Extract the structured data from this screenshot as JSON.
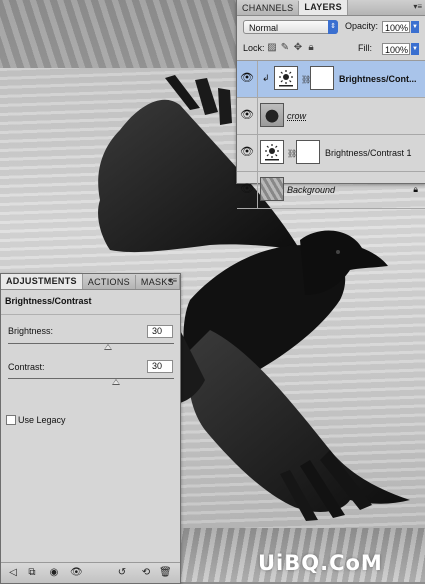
{
  "layers_panel": {
    "tabs": [
      "CHANNELS",
      "LAYERS"
    ],
    "active_tab": "LAYERS",
    "blend_mode": "Normal",
    "opacity_label": "Opacity:",
    "opacity_value": "100%",
    "lock_label": "Lock:",
    "fill_label": "Fill:",
    "fill_value": "100%",
    "layers": [
      {
        "name": "Brightness/Cont...",
        "type": "adjustment",
        "selected": true,
        "clipped": true
      },
      {
        "name": "crow",
        "type": "image",
        "selected": false
      },
      {
        "name": "Brightness/Contrast 1",
        "type": "adjustment",
        "selected": false
      },
      {
        "name": "Background",
        "type": "background",
        "selected": false,
        "locked": true
      }
    ]
  },
  "adjustments_panel": {
    "tabs": [
      "ADJUSTMENTS",
      "ACTIONS",
      "MASKS"
    ],
    "active_tab": "ADJUSTMENTS",
    "title": "Brightness/Contrast",
    "brightness_label": "Brightness:",
    "brightness_value": "30",
    "contrast_label": "Contrast:",
    "contrast_value": "30",
    "use_legacy_label": "Use Legacy",
    "use_legacy_checked": false
  },
  "icons": {
    "eye": "eye-icon",
    "lock": "lock-icon",
    "link": "chain-link-icon",
    "panel_menu": "panel-menu-icon"
  },
  "watermark": "UiBQ.CoM"
}
